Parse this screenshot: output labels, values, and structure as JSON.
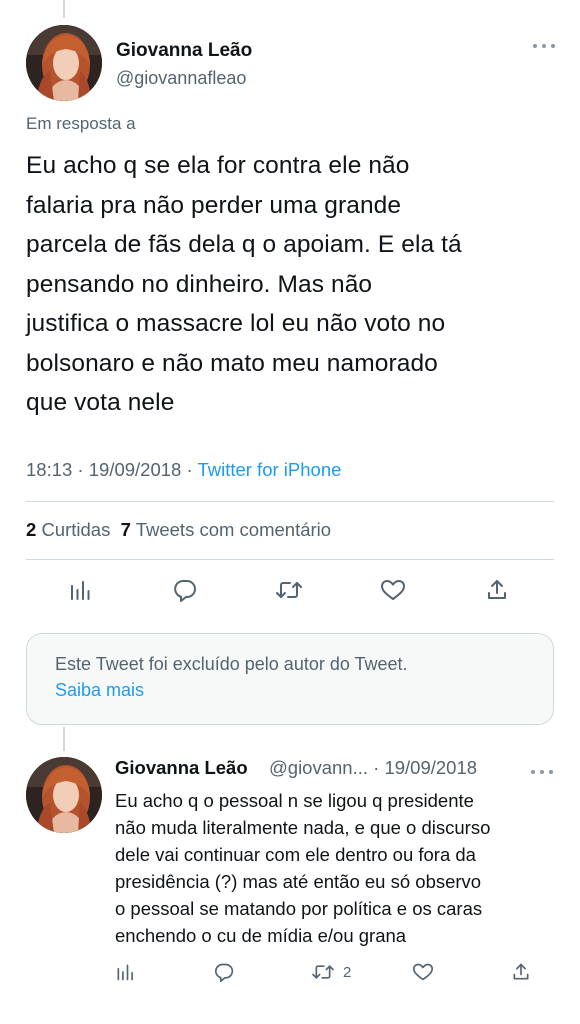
{
  "main_tweet": {
    "name": "Giovanna Leão",
    "handle": "@giovannafleao",
    "reply_to": "Em resposta a",
    "text_lines": [
      "Eu acho q se ela for contra ele não",
      "falaria pra não perder uma grande",
      "parcela de fãs dela q o apoiam. E ela tá",
      "pensando no dinheiro. Mas não",
      "justifica o massacre lol eu não voto no",
      "bolsonaro e não mato meu namorado",
      "que vota nele"
    ],
    "time_date": "18:13 · 19/09/2018 · ",
    "source": "Twitter for iPhone",
    "likes_count": "2",
    "likes_label": "Curtidas",
    "quotes_count": "7",
    "quotes_label": "Tweets com comentário",
    "actions": [
      "analytics-icon",
      "reply-icon",
      "retweet-icon",
      "like-icon",
      "share-icon"
    ]
  },
  "deleted_notice": {
    "text": "Este Tweet foi excluído pelo autor do Tweet.",
    "link": "Saiba mais"
  },
  "reply_tweet": {
    "name": "Giovanna Leão",
    "handle_date": "@giovann... · 19/09/2018",
    "text_lines": [
      "Eu acho q o pessoal n se ligou q presidente",
      "não muda literalmente nada, e que o discurso",
      "dele vai continuar com ele dentro ou fora da",
      "presidência (?) mas até então eu só observo",
      "o pessoal se matando por política e os caras",
      "enchendo o cu de mídia e/ou grana"
    ],
    "retweet_count": "2"
  },
  "colors": {
    "text": "#0f1419",
    "secondary": "#536471",
    "link": "#1d9bf0",
    "border": "#cfd9de",
    "notice_bg": "#f7f9f9"
  }
}
